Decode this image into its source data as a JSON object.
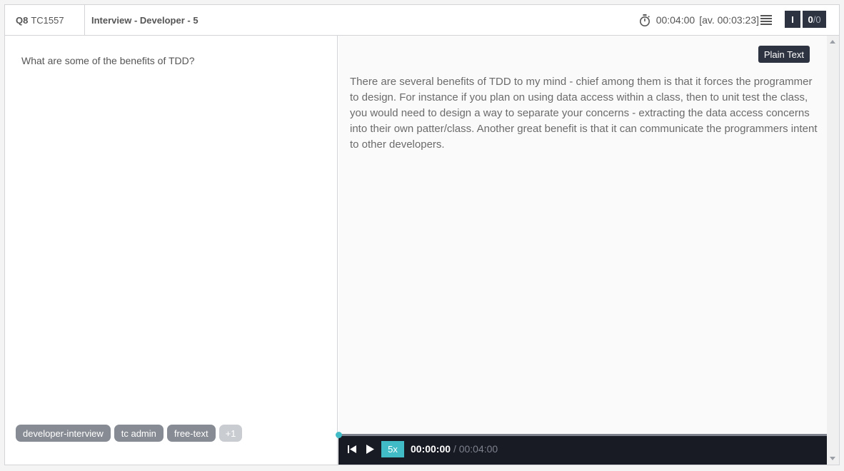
{
  "header": {
    "question_num": "Q8",
    "question_code": "TC1557",
    "title": "Interview - Developer - 5",
    "timer": "00:04:00",
    "average": "[av. 00:03:23]",
    "indicator": "I",
    "counter_current": "0",
    "counter_sep": "/",
    "counter_total": "0"
  },
  "left": {
    "question": "What are some of the benefits of TDD?",
    "tags": [
      "developer-interview",
      "tc admin",
      "free-text"
    ],
    "more_tags": "+1"
  },
  "right": {
    "format_button": "Plain Text",
    "answer": "There are several benefits of TDD to my mind - chief among them is that it forces the programmer to design. For instance if you plan on using data access within a class, then to unit test the class, you would need to design a way to separate your concerns - extracting the data access concerns into their own patter/class. Another great benefit is that it can communicate the programmers intent to other developers."
  },
  "player": {
    "speed": "5x",
    "current_time": "00:00:00",
    "separator": "/",
    "total_time": "00:04:00",
    "progress": 0
  },
  "icons": {
    "timer": "stopwatch-icon",
    "menu": "list-icon",
    "skip_back": "skip-back-icon",
    "play": "play-icon"
  },
  "colors": {
    "dark": "#2d3340",
    "accent": "#41bcc6",
    "tag": "#878b93",
    "player_bg": "#181a24"
  }
}
